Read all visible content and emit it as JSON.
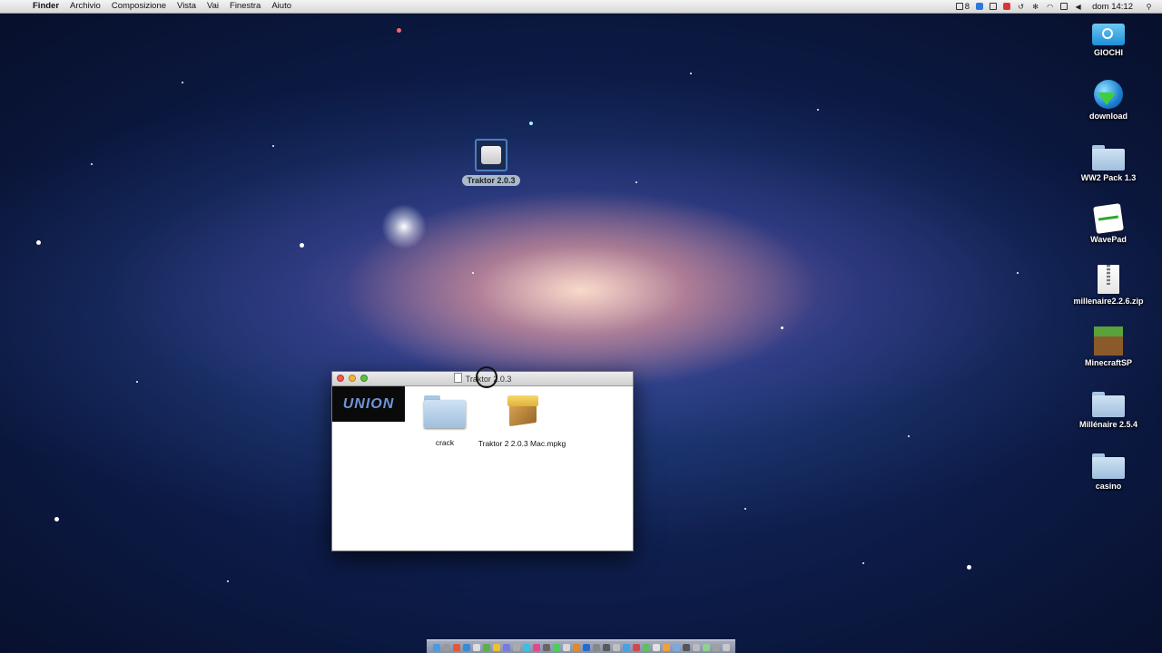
{
  "menubar": {
    "apple_glyph": "",
    "app_name": "Finder",
    "menus": [
      "Archivio",
      "Composizione",
      "Vista",
      "Vai",
      "Finestra",
      "Aiuto"
    ],
    "status": {
      "badge_count": "8",
      "clock": "dom 14:12"
    }
  },
  "desktop": {
    "selected_volume_label": "Traktor 2.0.3",
    "right_icons": [
      {
        "label": "GIOCHI",
        "icon": "drive-icon"
      },
      {
        "label": "download",
        "icon": "globe-download-icon"
      },
      {
        "label": "WW2 Pack 1.3",
        "icon": "folder-icon"
      },
      {
        "label": "WavePad",
        "icon": "wavepad-icon"
      },
      {
        "label": "millenaire2.2.6.zip",
        "icon": "zip-icon"
      },
      {
        "label": "MinecraftSP",
        "icon": "minecraft-icon"
      },
      {
        "label": "Millénaire 2.5.4",
        "icon": "folder-icon"
      },
      {
        "label": "casino",
        "icon": "folder-icon"
      }
    ]
  },
  "window": {
    "title": "Traktor 2.0.3",
    "banner_text": "UNION",
    "items": [
      {
        "label": "crack",
        "icon": "folder-icon"
      },
      {
        "label": "Traktor 2 2.0.3 Mac.mpkg",
        "icon": "package-icon"
      }
    ]
  },
  "colors": {
    "menubar_bg": "#e6e6e6",
    "union_text": "#6f95d8",
    "folder_blue": "#b7d1ea"
  }
}
